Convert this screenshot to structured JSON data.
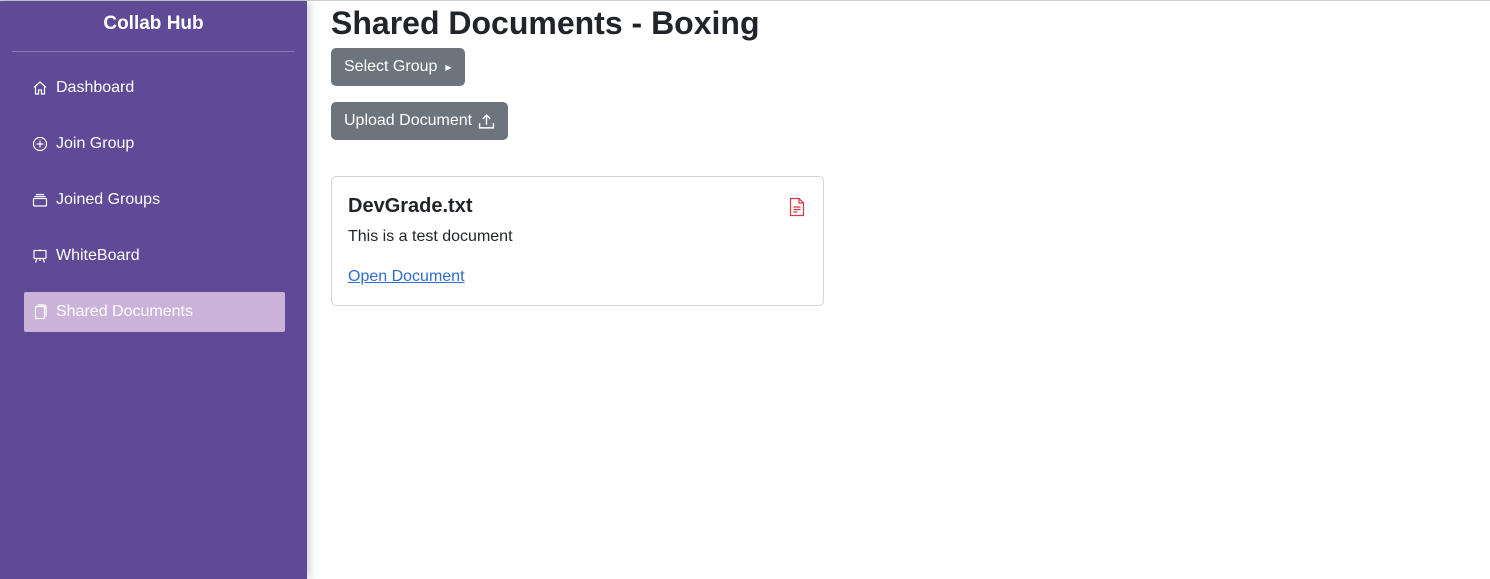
{
  "sidebar": {
    "brand": "Collab Hub",
    "items": [
      {
        "label": "Dashboard",
        "icon": "house-icon",
        "active": false
      },
      {
        "label": "Join Group",
        "icon": "plus-circle-icon",
        "active": false
      },
      {
        "label": "Joined Groups",
        "icon": "collection-icon",
        "active": false
      },
      {
        "label": "WhiteBoard",
        "icon": "easel-icon",
        "active": false
      },
      {
        "label": "Shared Documents",
        "icon": "files-icon",
        "active": true
      }
    ]
  },
  "main": {
    "title": "Shared Documents - Boxing",
    "select_group_label": "Select Group",
    "upload_label": "Upload Document",
    "documents": [
      {
        "name": "DevGrade.txt",
        "description": "This is a test document",
        "link_label": "Open Document",
        "icon": "file-text-icon"
      }
    ]
  },
  "colors": {
    "sidebar_bg": "#5e4a96",
    "active_item_bg": "#cbb2d9",
    "button_bg": "#6c757d",
    "link": "#2f6ecf",
    "file_icon": "#dc3545"
  }
}
